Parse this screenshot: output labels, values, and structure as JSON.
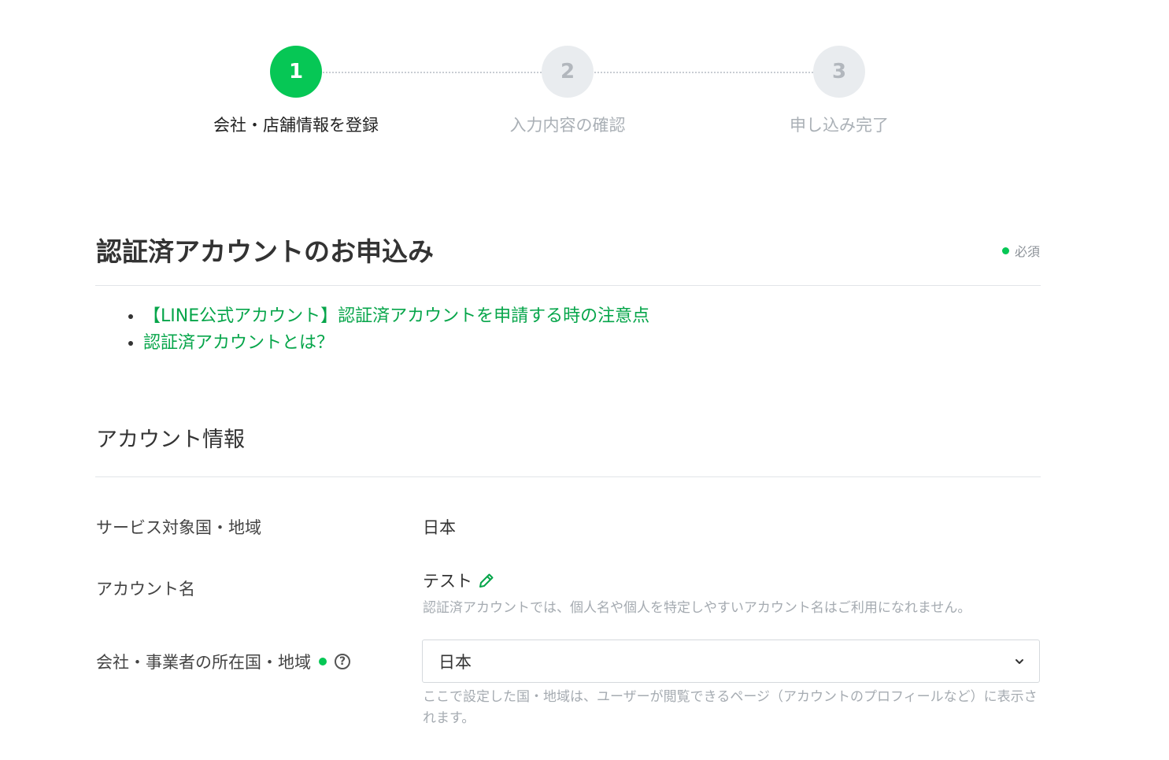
{
  "stepper": {
    "steps": [
      {
        "number": "1",
        "label": "会社・店舗情報を登録",
        "state": "active"
      },
      {
        "number": "2",
        "label": "入力内容の確認",
        "state": "inactive"
      },
      {
        "number": "3",
        "label": "申し込み完了",
        "state": "inactive"
      }
    ]
  },
  "header": {
    "title": "認証済アカウントのお申込み",
    "required_note": "必須"
  },
  "links": [
    "【LINE公式アカウント】認証済アカウントを申請する時の注意点",
    "認証済アカウントとは？"
  ],
  "section": {
    "title": "アカウント情報",
    "fields": {
      "service_region": {
        "label": "サービス対象国・地域",
        "value": "日本"
      },
      "account_name": {
        "label": "アカウント名",
        "value": "テスト",
        "hint": "認証済アカウントでは、個人名や個人を特定しやすいアカウント名はご利用になれません。"
      },
      "company_location": {
        "label": "会社・事業者の所在国・地域",
        "help": "?",
        "selected": "日本",
        "hint": "ここで設定した国・地域は、ユーザーが閲覧できるページ（アカウントのプロフィールなど）に表示されます。"
      }
    }
  },
  "colors": {
    "accent": "#06c755",
    "link": "#06a54a",
    "inactive_step": "#e9ecef"
  },
  "icons": {
    "edit": "pencil-icon",
    "help": "question-circle-icon",
    "dropdown": "chevron-down-icon",
    "required": "required-dot-icon"
  }
}
